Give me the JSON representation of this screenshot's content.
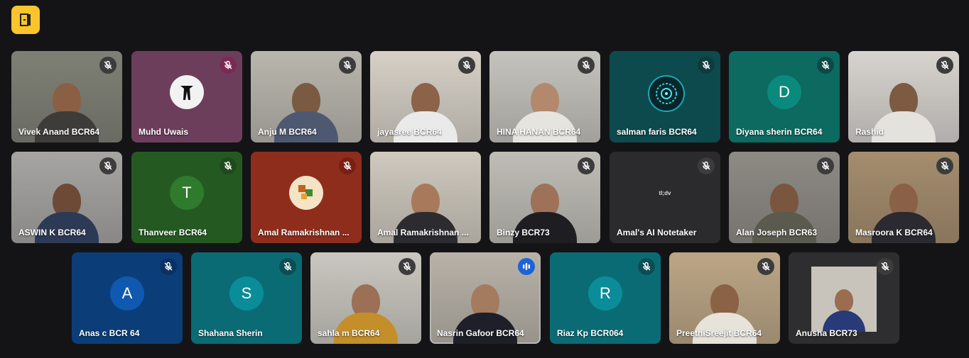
{
  "topbar": {
    "icon": "door-exit-icon",
    "accent": "#f9c52a"
  },
  "participants": [
    {
      "name": "Vivek Anand BCR64",
      "type": "video",
      "bg": "#7f8075",
      "skin": "#8a5f44",
      "shirt": "#3e3c38",
      "mic": "muted",
      "mic_bg": "#3c3c3c"
    },
    {
      "name": "Muhd Uwais",
      "type": "image",
      "bg": "#6d3e5c",
      "mic": "muted",
      "mic_bg": "#7a2a55",
      "image": "samurai-avatar"
    },
    {
      "name": "Anju M BCR64",
      "type": "video",
      "bg": "#b9b6ad",
      "skin": "#7a5a40",
      "shirt": "#4e5870",
      "mic": "muted",
      "mic_bg": "#3c3c3c"
    },
    {
      "name": "jayasree BCR64",
      "type": "video",
      "bg": "#d6d0c6",
      "skin": "#8c6248",
      "shirt": "#eaeaea",
      "mic": "muted",
      "mic_bg": "#3c3c3c"
    },
    {
      "name": "HINA HANAN BCR64",
      "type": "video",
      "bg": "#c5c3bd",
      "skin": "#b3886c",
      "shirt": "#e6e4de",
      "mic": "muted",
      "mic_bg": "#3c3c3c"
    },
    {
      "name": "salman faris BCR64",
      "type": "image",
      "bg": "#0d4a4d",
      "mic": "muted",
      "mic_bg": "#0f3b3f",
      "image": "tech-circle-avatar"
    },
    {
      "name": "Diyana sherin BCR64",
      "type": "initial",
      "bg": "#0c6a60",
      "initial": "D",
      "circle": "#0a8a7d",
      "mic": "muted",
      "mic_bg": "#0b4a44"
    },
    {
      "name": "Rashid",
      "type": "video",
      "bg": "#d7d4cf",
      "skin": "#7d5a42",
      "shirt": "#e3e2dc",
      "mic": "muted",
      "mic_bg": "#3c3c3c"
    },
    {
      "name": "ASWIN K BCR64",
      "type": "video",
      "bg": "#a7a5a2",
      "skin": "#6c4a36",
      "shirt": "#2d3a56",
      "mic": "muted",
      "mic_bg": "#3c3c3c"
    },
    {
      "name": "Thanveer BCR64",
      "type": "initial",
      "bg": "#245a22",
      "initial": "T",
      "circle": "#2f7a2c",
      "mic": "muted",
      "mic_bg": "#1f4a1d"
    },
    {
      "name": "Amal Ramakrishnan ...",
      "type": "image",
      "bg": "#8f2d1c",
      "mic": "muted",
      "mic_bg": "#7a1f14",
      "image": "pixel-art-avatar"
    },
    {
      "name": "Amal Ramakrishnan ...",
      "type": "video",
      "bg": "#cfc9be",
      "skin": "#a8795a",
      "shirt": "#2c2c30",
      "mic": "none",
      "mic_bg": ""
    },
    {
      "name": "Binzy BCR73",
      "type": "video",
      "bg": "#bfbdb6",
      "skin": "#9e7258",
      "shirt": "#1e1d22",
      "mic": "muted",
      "mic_bg": "#3c3c3c"
    },
    {
      "name": "Amal's AI Notetaker",
      "type": "notetaker",
      "bg": "#2b2b2e",
      "mic": "muted",
      "mic_bg": "#3c3c3c",
      "logo_text": "tl;dv"
    },
    {
      "name": "Alan Joseph BCR63",
      "type": "video",
      "bg": "#8e8b85",
      "skin": "#7a563e",
      "shirt": "#5a5a4e",
      "mic": "muted",
      "mic_bg": "#3c3c3c"
    },
    {
      "name": "Masroora K BCR64",
      "type": "video",
      "bg": "#a58d6e",
      "skin": "#8a6046",
      "shirt": "#2a2a30",
      "mic": "muted",
      "mic_bg": "#3c3c3c"
    },
    {
      "name": "Anas c BCR 64",
      "type": "initial",
      "bg": "#0b3e78",
      "initial": "A",
      "circle": "#0f5ab0",
      "mic": "muted",
      "mic_bg": "#0b3163"
    },
    {
      "name": "Shahana Sherin",
      "type": "initial",
      "bg": "#0b6b74",
      "initial": "S",
      "circle": "#0a8d98",
      "mic": "muted",
      "mic_bg": "#0a4e55"
    },
    {
      "name": "sahla m BCR64",
      "type": "video",
      "bg": "#c9c7bf",
      "skin": "#9b7056",
      "shirt": "#c48f2a",
      "mic": "muted",
      "mic_bg": "#3c3c3c"
    },
    {
      "name": "Nasrin Gafoor BCR64",
      "type": "video",
      "bg": "#b8b2a8",
      "skin": "#a47b5f",
      "shirt": "#1f1f2a",
      "mic": "speaking",
      "mic_bg": "#1e63d6"
    },
    {
      "name": "Riaz Kp BCR064",
      "type": "initial",
      "bg": "#0b6b74",
      "initial": "R",
      "circle": "#0a8d98",
      "mic": "muted",
      "mic_bg": "#0a4e55"
    },
    {
      "name": "PreethiSreejit BCR64",
      "type": "video",
      "bg": "#bca686",
      "skin": "#8c6246",
      "shirt": "#e7e3da",
      "mic": "muted",
      "mic_bg": "#3c3c3c"
    },
    {
      "name": "Anusha BCR73",
      "type": "inset",
      "bg": "#2e2e30",
      "skin": "#9a6c50",
      "shirt": "#283a78",
      "inset_bg": "#c8c4bb",
      "mic": "muted",
      "mic_bg": "#3c3c3c"
    }
  ]
}
